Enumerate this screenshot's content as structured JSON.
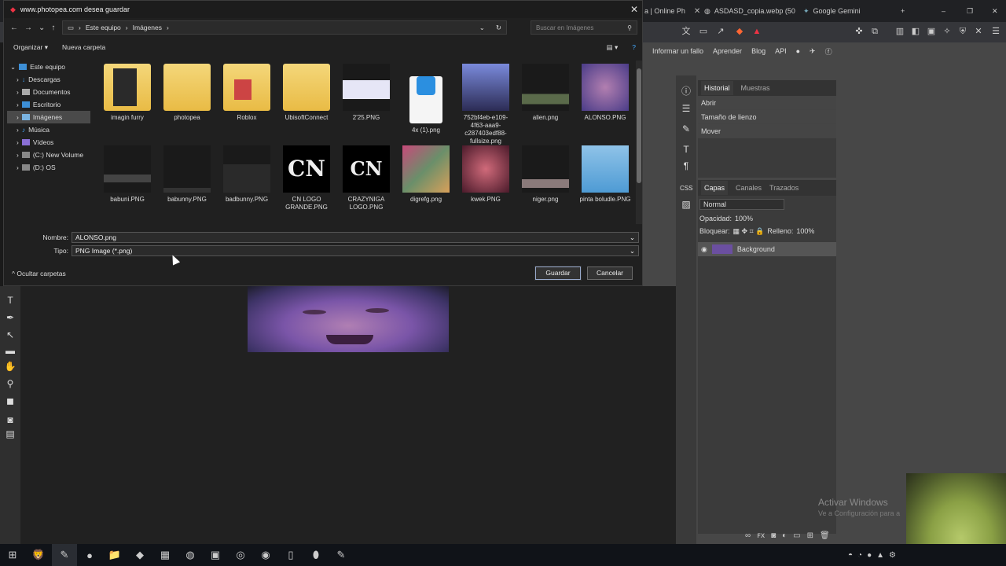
{
  "browser": {
    "tabs": [
      {
        "label": "a | Online Ph"
      },
      {
        "label": "ASDASD_copia.webp (50"
      },
      {
        "label": "Google Gemini"
      }
    ]
  },
  "photopea": {
    "menu": [
      "Informar un fallo",
      "Aprender",
      "Blog",
      "API"
    ],
    "history_tabs": [
      "Historial",
      "Muestras"
    ],
    "history": [
      "Abrir",
      "Tamaño de lienzo",
      "Mover"
    ],
    "layers_tabs": [
      "Capas",
      "Canales",
      "Trazados"
    ],
    "blend_mode": "Normal",
    "opacity_label": "Opacidad:",
    "opacity_value": "100%",
    "lock_label": "Bloquear:",
    "fill_label": "Relleno:",
    "fill_value": "100%",
    "layer_name": "Background",
    "css_label": "CSS"
  },
  "watermark": {
    "line1": "Activar Windows",
    "line2": "Ve a Configuración para a"
  },
  "dialog": {
    "title": "www.photopea.com desea guardar",
    "breadcrumb": [
      "Este equipo",
      "Imágenes"
    ],
    "search_placeholder": "Buscar en Imágenes",
    "organize": "Organizar",
    "new_folder": "Nueva carpeta",
    "nav": [
      {
        "label": "Este equipo"
      },
      {
        "label": "Descargas"
      },
      {
        "label": "Documentos"
      },
      {
        "label": "Escritorio"
      },
      {
        "label": "Imágenes"
      },
      {
        "label": "Música"
      },
      {
        "label": "Vídeos"
      },
      {
        "label": "(C:) New Volume"
      },
      {
        "label": "(D:) OS"
      }
    ],
    "files": [
      {
        "name": "imagin furry"
      },
      {
        "name": "photopea"
      },
      {
        "name": "Roblox"
      },
      {
        "name": "UbisoftConnect"
      },
      {
        "name": "2'25.PNG"
      },
      {
        "name": "4x (1).png"
      },
      {
        "name": "752bf4eb-e109-4f63-aaa9-c287403edf88-fullsize.png"
      },
      {
        "name": "alien.png"
      },
      {
        "name": "ALONSO.PNG"
      },
      {
        "name": "babuni.PNG"
      },
      {
        "name": "babunny.PNG"
      },
      {
        "name": "badbunny.PNG"
      },
      {
        "name": "CN LOGO GRANDE.PNG"
      },
      {
        "name": "CRAZYNIGA LOGO.PNG"
      },
      {
        "name": "digrefg.png"
      },
      {
        "name": "kwek.PNG"
      },
      {
        "name": "niger.png"
      },
      {
        "name": "pinta boludle.PNG"
      }
    ],
    "filename_label": "Nombre:",
    "filename_value": "ALONSO.png",
    "type_label": "Tipo:",
    "type_value": "PNG Image (*.png)",
    "hide_folders": "Ocultar carpetas",
    "save": "Guardar",
    "cancel": "Cancelar"
  }
}
